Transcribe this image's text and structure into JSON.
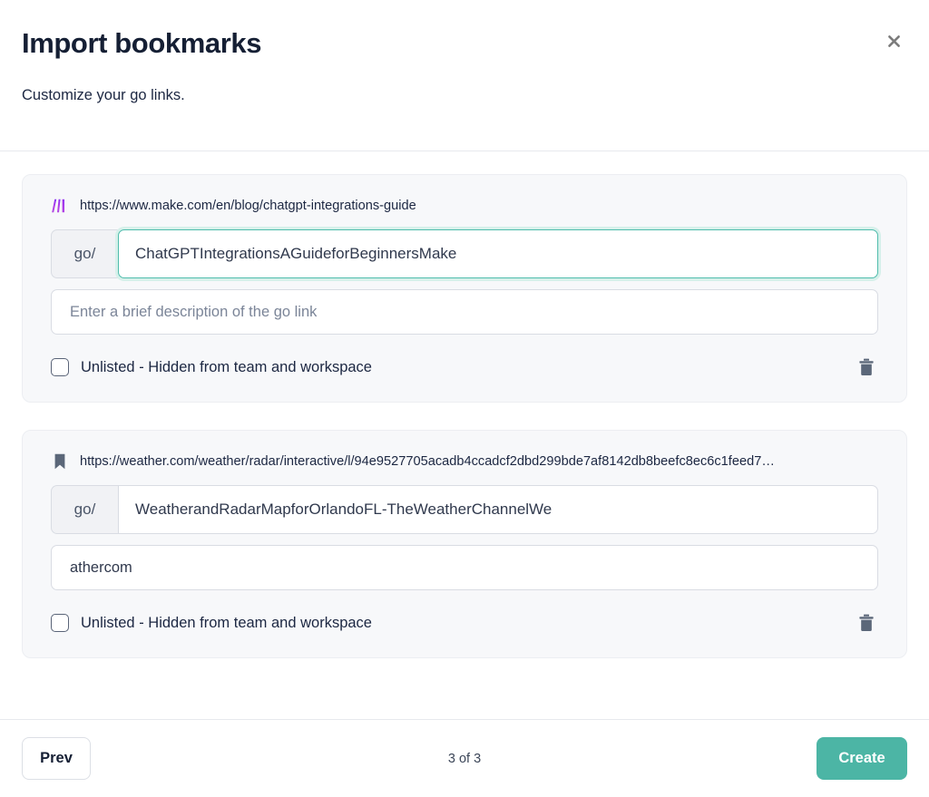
{
  "modal": {
    "title": "Import bookmarks",
    "subtitle": "Customize your go links.",
    "close_icon": "close-icon"
  },
  "colors": {
    "accent": "#4cb5a5",
    "focus_border": "#4fbcac",
    "focus_ring": "#d6f0ea",
    "card_bg": "#f7f8fa",
    "text": "#1c2742"
  },
  "cards": [
    {
      "favicon": "make-logo-icon",
      "url": "https://www.make.com/en/blog/chatgpt-integrations-guide",
      "slug_prefix": "go/",
      "slug_value": "ChatGPTIntegrationsAGuideforBeginnersMake",
      "slug_focused": true,
      "description_value": "",
      "description_placeholder": "Enter a brief description of the go link",
      "unlisted_label": "Unlisted - Hidden from team and workspace",
      "unlisted_checked": false,
      "delete_icon": "trash-icon"
    },
    {
      "favicon": "bookmark-icon",
      "url": "https://weather.com/weather/radar/interactive/l/94e9527705acadb4ccadcf2dbd299bde7af8142db8beefc8ec6c1feed7…",
      "slug_prefix": "go/",
      "slug_value": "WeatherandRadarMapforOrlandoFL-TheWeatherChannelWe",
      "slug_focused": false,
      "description_value": "athercom",
      "description_placeholder": "Enter a brief description of the go link",
      "unlisted_label": "Unlisted - Hidden from team and workspace",
      "unlisted_checked": false,
      "delete_icon": "trash-icon"
    }
  ],
  "footer": {
    "prev_label": "Prev",
    "page_indicator": "3 of 3",
    "create_label": "Create"
  }
}
